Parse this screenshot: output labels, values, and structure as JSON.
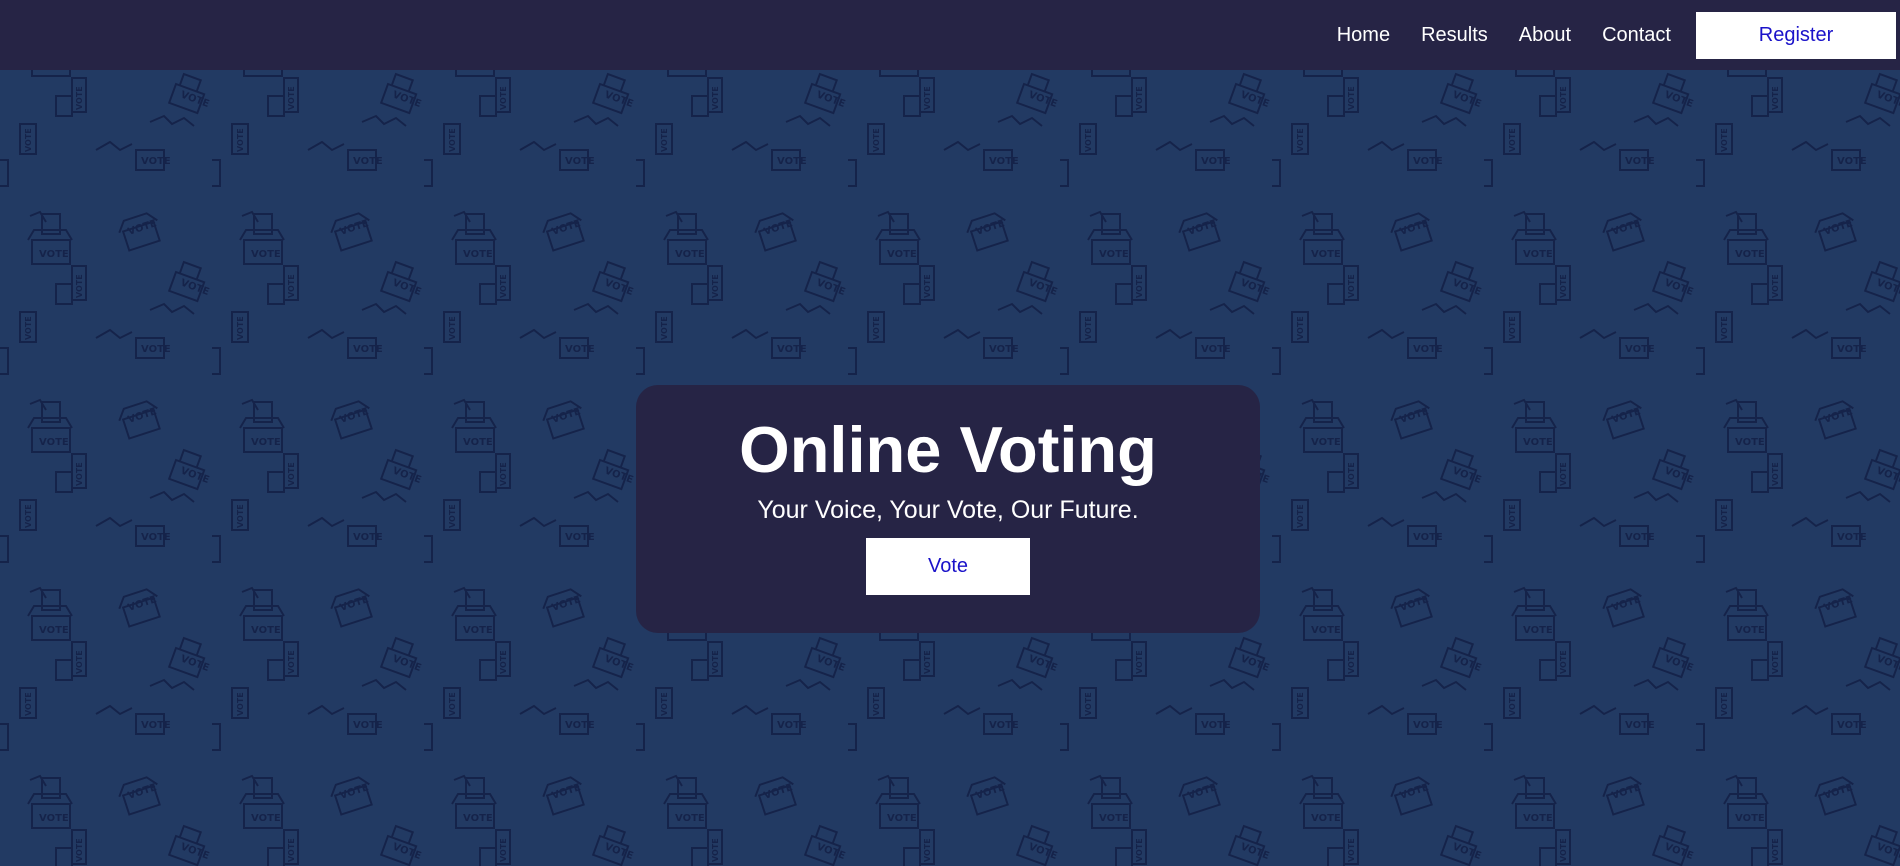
{
  "nav": {
    "links": [
      "Home",
      "Results",
      "About",
      "Contact"
    ],
    "register_label": "Register"
  },
  "hero": {
    "title": "Online Voting",
    "subtitle": "Your Voice, Your Vote, Our Future.",
    "vote_label": "Vote"
  },
  "background": {
    "pattern_text": "VOTE",
    "pattern_icon": "ballot-box-icon"
  },
  "colors": {
    "background": "#223a63",
    "navbar": "#262445",
    "card": "#262445",
    "button_text": "#1a12c9",
    "pattern_stroke": "#15234a"
  }
}
